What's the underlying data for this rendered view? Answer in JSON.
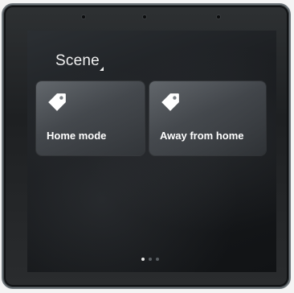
{
  "screen": {
    "title": "Scene"
  },
  "scenes": [
    {
      "label": "Home mode",
      "icon": "tag-icon"
    },
    {
      "label": "Away from home",
      "icon": "tag-icon"
    }
  ],
  "pager": {
    "pages": 3,
    "current": 1
  }
}
